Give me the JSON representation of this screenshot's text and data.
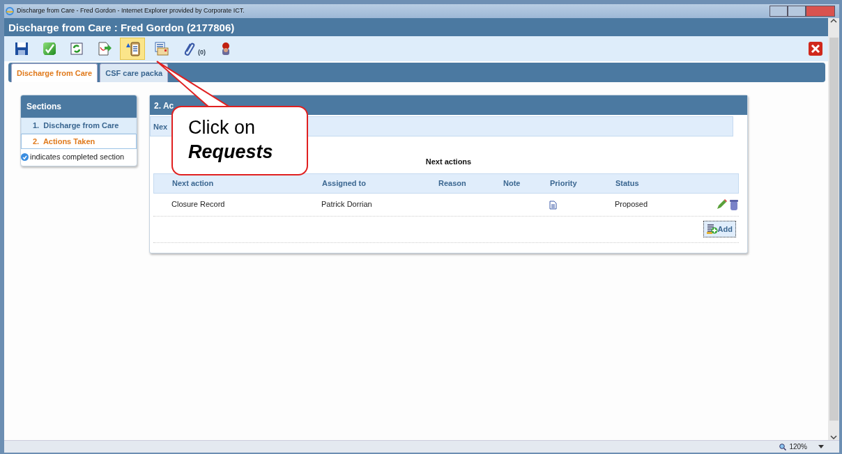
{
  "window": {
    "title": "Discharge from Care - Fred Gordon - Internet Explorer provided by Corporate ICT."
  },
  "header": {
    "title": "Discharge from Care :  Fred Gordon  (2177806)"
  },
  "toolbar": [
    {
      "kind": "save",
      "selected": false
    },
    {
      "kind": "complete",
      "selected": false
    },
    {
      "kind": "refresh",
      "selected": false
    },
    {
      "kind": "export",
      "selected": false
    },
    {
      "kind": "requests",
      "selected": true
    },
    {
      "kind": "letter",
      "selected": false
    },
    {
      "kind": "attachments",
      "selected": false,
      "count": "(0)"
    },
    {
      "kind": "person",
      "selected": false
    }
  ],
  "tabs": [
    {
      "label": "Discharge from Care",
      "selected": true
    },
    {
      "label": "CSF care packa",
      "selected": false
    }
  ],
  "sections": {
    "title": "Sections",
    "items": [
      {
        "number": "1.",
        "label": "Discharge from Care",
        "selected": false
      },
      {
        "number": "2.",
        "label": "Actions Taken",
        "selected": true
      }
    ],
    "legend": "indicates completed section"
  },
  "panel": {
    "title": "2. Ac",
    "subheader": "Nex",
    "table_title": "Next actions",
    "columns": [
      "Next action",
      "Assigned to",
      "Reason",
      "Note",
      "Priority",
      "Status"
    ],
    "rows": [
      {
        "next_action": "Closure Record",
        "assigned_to": "Patrick Dorrian",
        "status": "Proposed"
      }
    ],
    "add_button": "Add"
  },
  "callout": {
    "text": "Click on **Requests**"
  },
  "status_bar": {
    "zoom": "120%"
  }
}
